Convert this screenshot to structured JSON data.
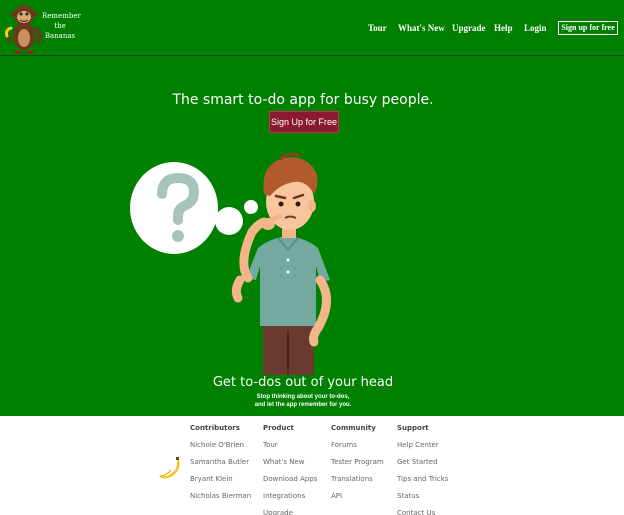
{
  "brand": {
    "logo_lines": [
      "Remember",
      "the",
      "Bananas"
    ]
  },
  "nav": {
    "tour": "Tour",
    "whats_new": "What's New",
    "upgrade": "Upgrade",
    "help": "Help",
    "login": "Login",
    "signup": "Sign up for free"
  },
  "hero": {
    "headline": "The smart to-do app for busy people.",
    "cta_label": "Sign Up for Free",
    "tagline": "Get to-dos out of your head",
    "subline": [
      "Stop thinking about your to-dos,",
      "and let the app remember for you."
    ]
  },
  "footer": {
    "columns": [
      {
        "title": "Contributors",
        "links": [
          "Nichole O'Brien",
          "Samantha Butler",
          "Bryant Klein",
          "Nicholas Bierman"
        ]
      },
      {
        "title": "Product",
        "links": [
          "Tour",
          "What's New",
          "Download Apps",
          "Integrations",
          "Upgrade"
        ]
      },
      {
        "title": "Community",
        "links": [
          "Forums",
          "Tester Program",
          "Translations",
          "API"
        ]
      },
      {
        "title": "Support",
        "links": [
          "Help Center",
          "Get Started",
          "Tips and Tricks",
          "Status",
          "Contact Us"
        ]
      }
    ]
  },
  "colors": {
    "hero_bg": "#008000",
    "cta_bg": "#8b1a2e",
    "footer_bg": "#ffffff"
  },
  "icons": {
    "logo": "monkey-logo-icon",
    "illustration": "thinking-man-icon",
    "question": "question-mark-icon",
    "footer": "banana-icon"
  }
}
